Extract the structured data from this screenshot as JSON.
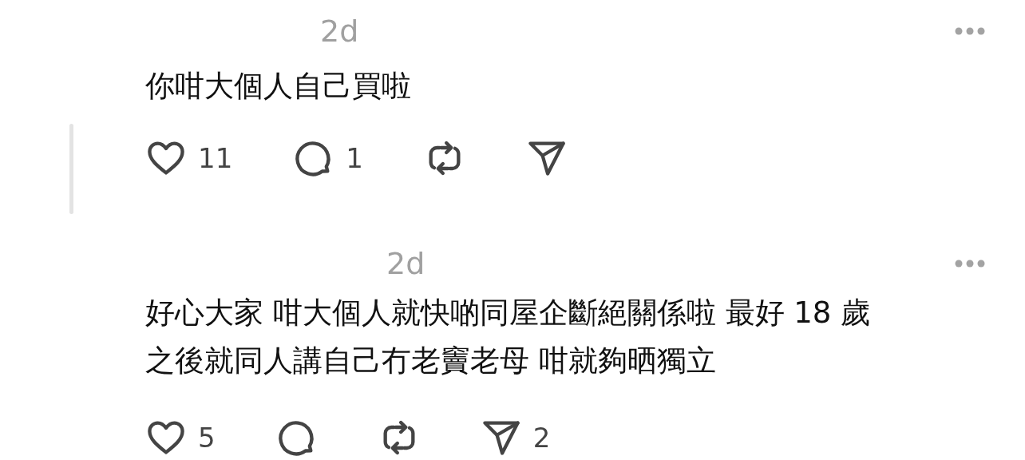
{
  "posts": [
    {
      "timestamp": "2d",
      "thread_line": true,
      "lines": [
        "你咁大個人自己買啦"
      ],
      "actions": [
        {
          "kind": "like",
          "count": "11"
        },
        {
          "kind": "reply",
          "count": "1"
        },
        {
          "kind": "repost"
        },
        {
          "kind": "share"
        }
      ]
    },
    {
      "timestamp": "2d",
      "thread_line": false,
      "lines": [
        "好心大家 咁大個人就快啲同屋企斷絕關係啦 最好 18 歲",
        "之後就同人講自己冇老竇老母 咁就夠晒獨立"
      ],
      "actions": [
        {
          "kind": "like",
          "count": "5"
        },
        {
          "kind": "reply"
        },
        {
          "kind": "repost"
        },
        {
          "kind": "share",
          "count": "2"
        }
      ]
    }
  ]
}
